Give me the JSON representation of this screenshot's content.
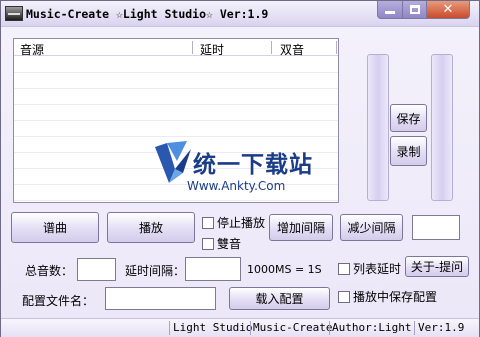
{
  "window": {
    "title": "Music-Create ☆Light Studio☆ Ver:1.9"
  },
  "list": {
    "columns": [
      "音源",
      "延时",
      "双音"
    ]
  },
  "watermark": {
    "brand": "统一下载站",
    "url": "Www.Ankty.Com"
  },
  "buttons": {
    "compose": "谱曲",
    "play": "播放",
    "add_interval": "增加间隔",
    "reduce_interval": "减少间隔",
    "save": "保存",
    "record": "录制",
    "load_config": "载入配置",
    "about": "关于-提问"
  },
  "checks": {
    "stop_play": "停止播放",
    "double_tone": "雙音",
    "list_delay": "列表延时",
    "save_in_play": "播放中保存配置"
  },
  "fields": {
    "total_notes_label": "总音数：",
    "delay_interval_label": "延时间隔：",
    "ms_note": "1000MS = 1S",
    "config_file_label": "配置文件名："
  },
  "statusbar": {
    "panels": [
      "Light Studio",
      "Music-Create",
      "Author:Light",
      "Ver:1.9"
    ]
  },
  "colors": {
    "accent": "#8f86c6",
    "close": "#c94b2a",
    "watermark": "#1b3d87"
  }
}
